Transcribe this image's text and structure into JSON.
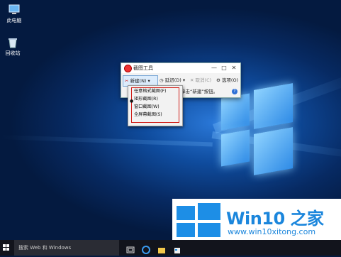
{
  "desktop": {
    "icons": [
      {
        "label": "此电脑",
        "icon": "computer-icon"
      },
      {
        "label": "回收站",
        "icon": "recycle-bin-icon"
      }
    ]
  },
  "snipping_tool": {
    "title": "截图工具",
    "toolbar": {
      "new_label": "新建(N)",
      "delay_label": "延迟(D)",
      "cancel_label": "取消(C)",
      "options_label": "选项(O)"
    },
    "hint_text": "单击“新建”按钮。",
    "window_controls": {
      "minimize": "—",
      "maximize": "□",
      "close": "✕"
    }
  },
  "new_menu": {
    "items": [
      "任意格式截图(F)",
      "矩形截图(R)",
      "窗口截图(W)",
      "全屏幕截图(S)"
    ],
    "selected_index": 1
  },
  "taskbar": {
    "search_placeholder": "搜索 Web 和 Windows"
  },
  "watermark": {
    "brand": "Win10 之家",
    "url": "www.win10xitong.com"
  },
  "colors": {
    "accent": "#1b86dc",
    "highlight_box": "#d0201a"
  }
}
